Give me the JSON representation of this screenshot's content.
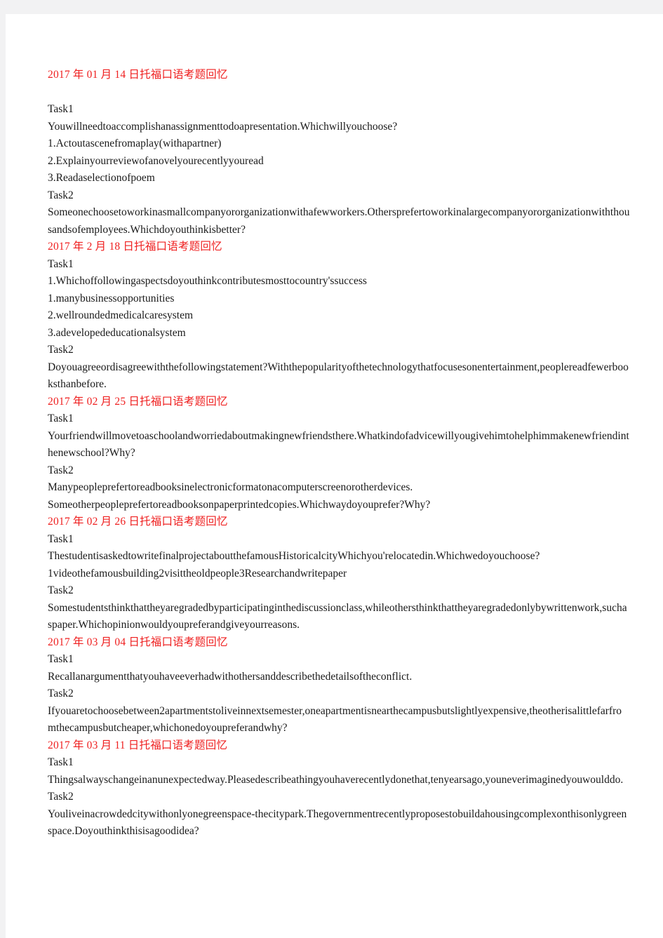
{
  "document": {
    "title_color": "#ef1f1f",
    "body_color": "#1a1a1a",
    "page_background": "#ffffff",
    "canvas_background": "#f2f2f3"
  },
  "sections": [
    {
      "heading": "2017 年 01 月 14 日托福口语考题回忆",
      "blocks": [
        {
          "label": "Task1"
        },
        {
          "text": "Youwillneedtoaccomplishanassignmenttodoapresentation.Whichwillyouchoose?"
        },
        {
          "text": "1.Actoutascenefromaplay(withapartner)"
        },
        {
          "text": "2.Explainyourreviewofanovelyourecentlyyouread"
        },
        {
          "text": "3.Readaselectionofpoem"
        },
        {
          "label": "Task2"
        },
        {
          "text": "Someonechoosetoworkinasmallcompanyororganizationwithafewworkers.Othersprefertoworkinalargecompanyororganizationwiththousandsofemployees.Whichdoyouthinkisbetter?"
        }
      ]
    },
    {
      "heading": "2017 年 2 月 18 日托福口语考题回忆",
      "blocks": [
        {
          "label": "Task1"
        },
        {
          "text": "1.Whichoffollowingaspectsdoyouthinkcontributesmosttocountry'ssuccess"
        },
        {
          "text": "1.manybusinessopportunities"
        },
        {
          "text": "2.wellroundedmedicalcaresystem"
        },
        {
          "text": "3.adevelopededucationalsystem"
        },
        {
          "label": "Task2"
        },
        {
          "text": "Doyouagreeordisagreewiththefollowingstatement?Withthepopularityofthetechnologythatfocusesonentertainment,peoplereadfewerbooksthanbefore."
        }
      ]
    },
    {
      "heading": "2017 年 02 月 25 日托福口语考题回忆",
      "blocks": [
        {
          "label": "Task1"
        },
        {
          "text": "Yourfriendwillmovetoaschoolandworriedaboutmakingnewfriendsthere.Whatkindofadvicewillyougivehimtohelphimmakenewfriendinthenewschool?Why?"
        },
        {
          "label": "Task2"
        },
        {
          "text": "Manypeopleprefertoreadbooksinelectronicformatonacomputerscreenorotherdevices."
        },
        {
          "text": "Someotherpeopleprefertoreadbooksonpaperprintedcopies.Whichwaydoyouprefer?Why?"
        }
      ]
    },
    {
      "heading": "2017 年 02 月 26 日托福口语考题回忆",
      "blocks": [
        {
          "label": "Task1"
        },
        {
          "text": "ThestudentisaskedtowritefinalprojectaboutthefamousHistoricalcityWhichyou'relocatedin.Whichwedoyouchoose?"
        },
        {
          "text": "1videothefamousbuilding2visittheoldpeople3Researchandwritepaper"
        },
        {
          "label": "Task2"
        },
        {
          "text": "Somestudentsthinkthattheyaregradedbyparticipatinginthediscussionclass,whileothersthinkthattheyaregradedonlybywrittenwork,suchaspaper.Whichopinionwouldyoupreferandgiveyourreasons."
        }
      ]
    },
    {
      "heading": "2017 年 03 月 04 日托福口语考题回忆",
      "blocks": [
        {
          "label": "Task1"
        },
        {
          "text": "Recallanargumentthatyouhaveeverhadwithothersanddescribethedetailsoftheconflict."
        },
        {
          "label": "Task2"
        },
        {
          "text": "Ifyouaretochoosebetween2apartmentstoliveinnextsemester,oneapartmentisnearthecampusbutslightlyexpensive,theotherisalittlefarfromthecampusbutcheaper,whichonedoyoupreferandwhy?"
        }
      ]
    },
    {
      "heading": "2017 年 03 月 11 日托福口语考题回忆",
      "blocks": [
        {
          "label": "Task1"
        },
        {
          "text": "Thingsalwayschangeinanunexpectedway.Pleasedescribeathingyouhaverecentlydonethat,tenyearsago,youneverimaginedyouwoulddo."
        },
        {
          "label": "Task2"
        },
        {
          "text": "Youliveinacrowdedcitywithonlyonegreenspace-thecitypark.Thegovernmentrecentlyproposestobuildahousingcomplexonthisonlygreenspace.Doyouthinkthisisagoodidea?"
        }
      ]
    }
  ]
}
